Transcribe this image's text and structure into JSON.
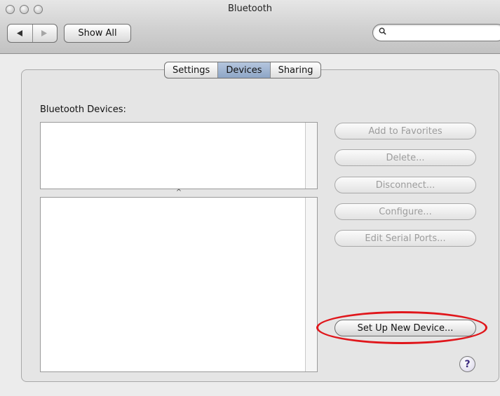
{
  "window": {
    "title": "Bluetooth"
  },
  "toolbar": {
    "back_icon": "back-arrow-icon",
    "forward_icon": "forward-arrow-icon",
    "show_all_label": "Show All",
    "search": {
      "value": "",
      "placeholder": "",
      "icon": "magnifier-icon"
    }
  },
  "tabs": [
    {
      "label": "Settings",
      "selected": false
    },
    {
      "label": "Devices",
      "selected": true
    },
    {
      "label": "Sharing",
      "selected": false
    }
  ],
  "devices": {
    "list_label": "Bluetooth Devices:",
    "splitter_glyph": "^"
  },
  "actions": [
    {
      "label": "Add to Favorites",
      "enabled": false
    },
    {
      "label": "Delete...",
      "enabled": false
    },
    {
      "label": "Disconnect...",
      "enabled": false
    },
    {
      "label": "Configure...",
      "enabled": false
    },
    {
      "label": "Edit Serial Ports...",
      "enabled": false
    },
    {
      "label": "Set Up New Device...",
      "enabled": true
    }
  ],
  "help": {
    "label": "?"
  },
  "colors": {
    "tab_selected": "#8ea6c6",
    "highlight": "#e0161b",
    "help_glyph": "#3b2a80"
  }
}
